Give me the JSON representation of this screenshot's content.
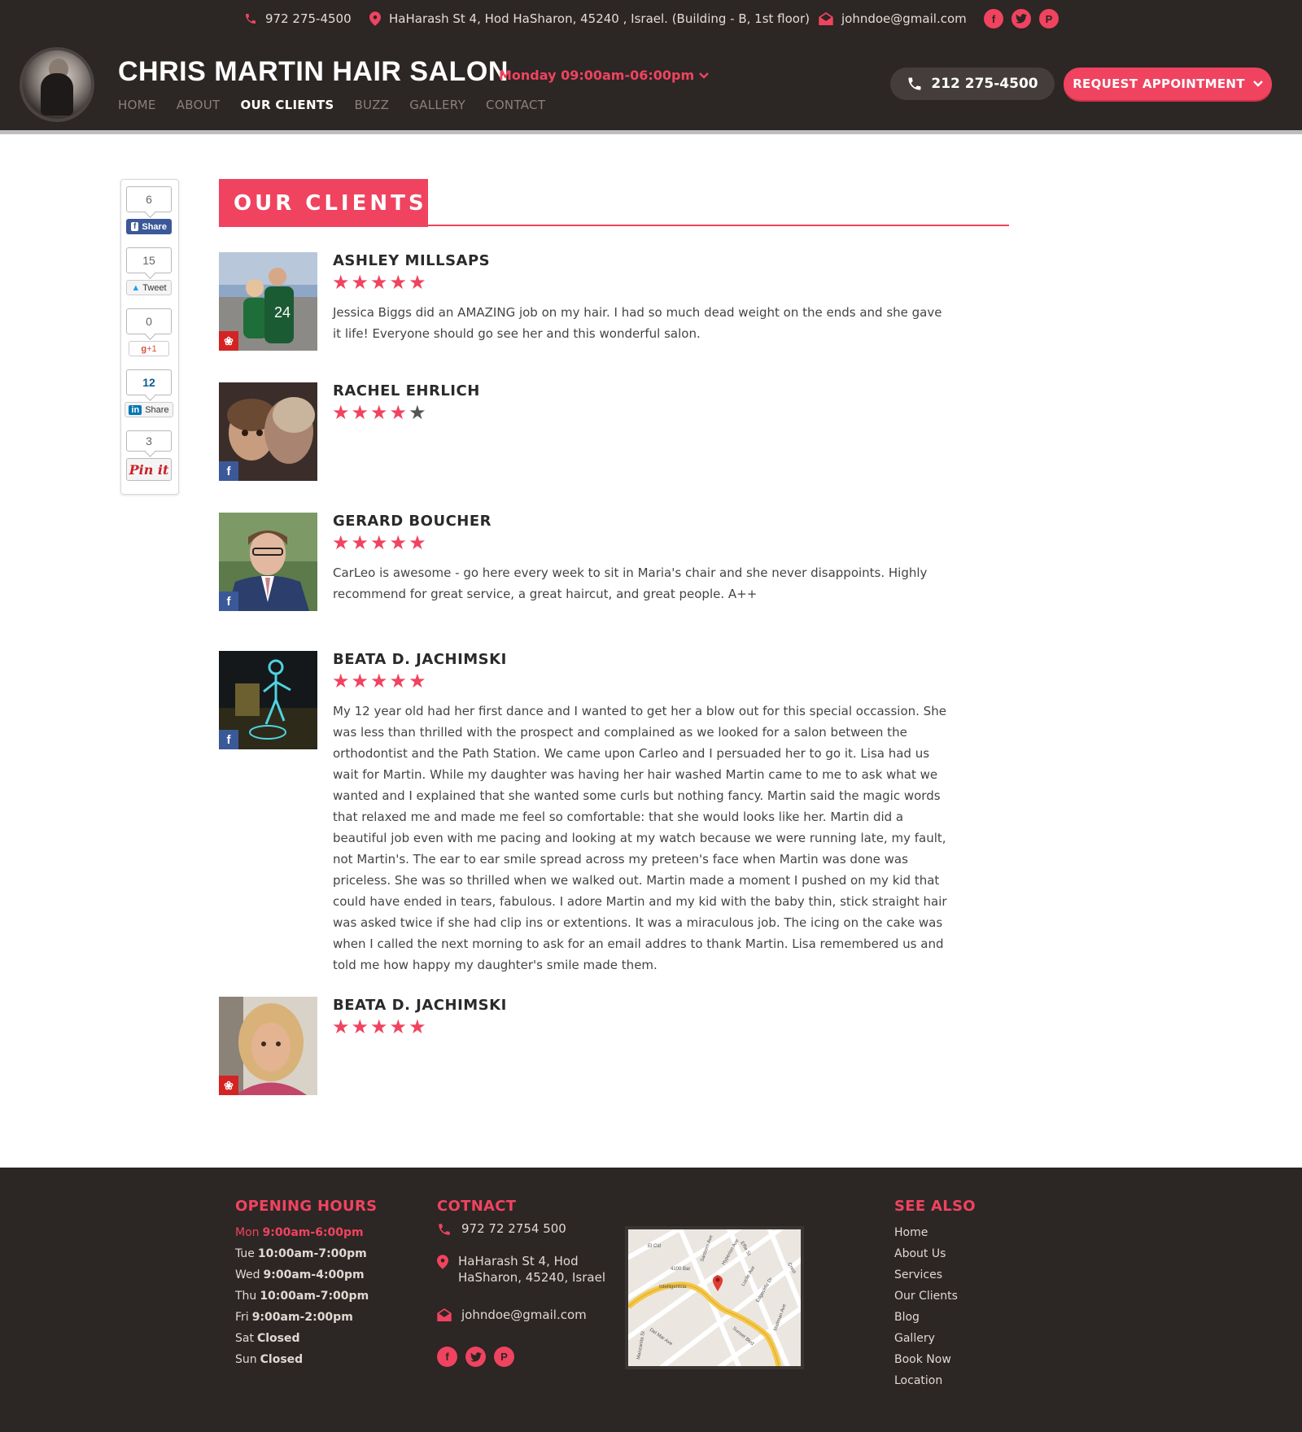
{
  "topbar": {
    "phone": "972 275-4500",
    "address": "HaHarash St 4, Hod HaSharon, 45240 , Israel. (Building - B, 1st floor)",
    "email": "johndoe@gmail.com",
    "social": [
      "facebook",
      "twitter",
      "pinterest"
    ]
  },
  "header": {
    "brand": "CHRIS MARTIN HAIR SALON",
    "hours": "Monday 09:00am-06:00pm",
    "phone": "212 275-4500",
    "appointment": "REQUEST APPOINTMENT",
    "nav": [
      {
        "label": "HOME",
        "active": false
      },
      {
        "label": "ABOUT",
        "active": false
      },
      {
        "label": "OUR CLIENTS",
        "active": true
      },
      {
        "label": "BUZZ",
        "active": false
      },
      {
        "label": "GALLERY",
        "active": false
      },
      {
        "label": "CONTACT",
        "active": false
      }
    ]
  },
  "share": {
    "facebook": {
      "count": "6",
      "label": "Share"
    },
    "twitter": {
      "count": "15",
      "label": "Tweet"
    },
    "googleplus": {
      "count": "0",
      "label": "+1"
    },
    "linkedin": {
      "count": "12",
      "label": "Share"
    },
    "pinterest": {
      "count": "3",
      "label": "Pin it"
    }
  },
  "section_title": "OUR CLIENTS",
  "reviews": [
    {
      "name": "ASHLEY MILLSAPS",
      "rating": 5,
      "source": "yelp",
      "text": "Jessica Biggs did an AMAZING job on my hair. I had so much dead weight on the ends and she gave it life! Everyone should go see her and this wonderful salon."
    },
    {
      "name": "RACHEL EHRLICH",
      "rating": 4,
      "source": "facebook",
      "text": ""
    },
    {
      "name": "GERARD BOUCHER",
      "rating": 5,
      "source": "facebook",
      "text": "CarLeo is awesome - go here every week to sit in Maria's chair and she never disappoints. Highly recommend for great service, a great haircut, and great people. A++"
    },
    {
      "name": "BEATA D. JACHIMSKI",
      "rating": 5,
      "source": "facebook",
      "text": "My 12 year old had her first dance and I wanted to get her a blow out for this special occassion. She was less than thrilled with the prospect and complained as we looked for a salon between the orthodontist and the Path Station. We came upon Carleo and I persuaded her to go it. Lisa had us wait for Martin. While my daughter was having her hair washed Martin came to me to ask what we wanted and I explained that she wanted some curls but nothing fancy. Martin said the magic words that relaxed me and made me feel so comfortable: that she would looks like her. Martin did a beautiful job even with me pacing and looking at my watch because we were running late, my fault, not Martin's. The ear to ear smile spread across my preteen's face when Martin was done was priceless. She was so thrilled when we walked out. Martin made a moment I pushed on my kid that could have ended in tears, fabulous. I adore Martin and my kid with the baby thin, stick straight hair was asked twice if she had clip ins or extentions. It was a miraculous job. The icing on the cake was when I called the next morning to ask for an email addres to thank Martin. Lisa remembered us and told me how happy my daughter's smile made them."
    },
    {
      "name": "BEATA D. JACHIMSKI",
      "rating": 5,
      "source": "yelp",
      "text": ""
    }
  ],
  "footer": {
    "hours_title": "OPENING HOURS",
    "hours": [
      {
        "day": "Mon",
        "time": "9:00am-6:00pm",
        "today": true
      },
      {
        "day": "Tue",
        "time": "10:00am-7:00pm",
        "today": false
      },
      {
        "day": "Wed",
        "time": "9:00am-4:00pm",
        "today": false
      },
      {
        "day": "Thu",
        "time": "10:00am-7:00pm",
        "today": false
      },
      {
        "day": "Fri",
        "time": "9:00am-2:00pm",
        "today": false
      },
      {
        "day": "Sat",
        "time": "Closed",
        "today": false
      },
      {
        "day": "Sun",
        "time": "Closed",
        "today": false
      }
    ],
    "contact_title": "COTNACT",
    "contact_phone": "972 72 2754 500",
    "contact_address_1": "HaHarash St 4, Hod",
    "contact_address_2": "HaSharon, 45240, Israel",
    "contact_email": "johndoe@gmail.com",
    "map_labels": [
      "El Cid",
      "4100 Bar",
      "Intelligentsia",
      "Sunset Blvd",
      "Hyperion Ave",
      "Effie St",
      "Lucile Ave",
      "Edgecliffe Dr",
      "Maltman Ave",
      "Del Mar Ave",
      "Sanborn Ave",
      "Manzanita St",
      "Crest"
    ],
    "see_title": "SEE ALSO",
    "see_links": [
      "Home",
      "About Us",
      "Services",
      "Our Clients",
      "Blog",
      "Gallery",
      "Book Now",
      "Location"
    ]
  },
  "colors": {
    "accent": "#f0435f",
    "dark": "#2c2624"
  }
}
